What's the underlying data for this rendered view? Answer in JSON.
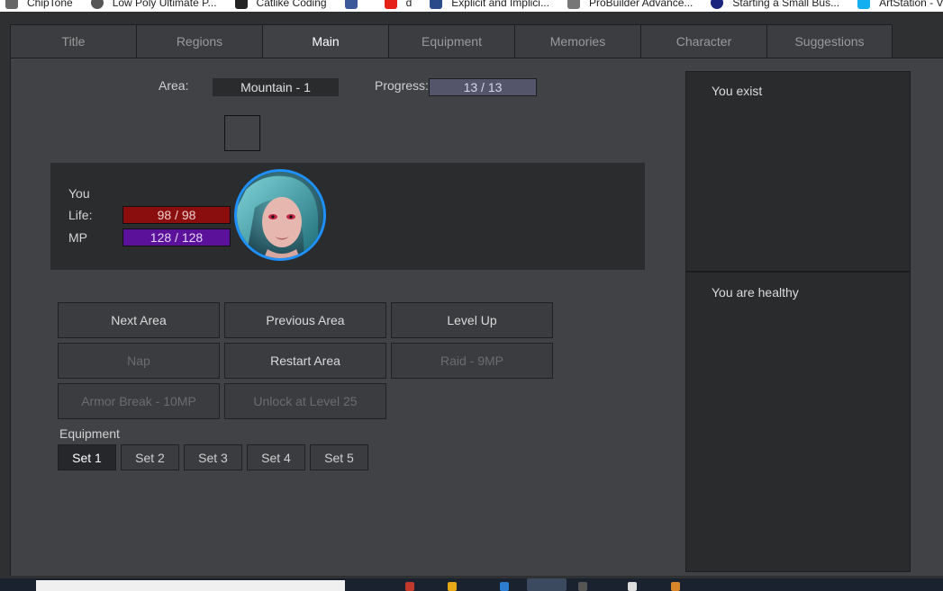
{
  "bookmarks": [
    {
      "label": "ChipTone",
      "color": "#666666"
    },
    {
      "label": "Low Poly Ultimate P...",
      "color": "#555555"
    },
    {
      "label": "Catlike Coding",
      "color": "#222222"
    },
    {
      "label": "",
      "color": "#3b5998"
    },
    {
      "label": "d",
      "color": "#e62117"
    },
    {
      "label": "Explicit and Implici...",
      "color": "#2b4a8a"
    },
    {
      "label": "ProBuilder Advance...",
      "color": "#777777"
    },
    {
      "label": "Starting a Small Bus...",
      "color": "#1a237e"
    },
    {
      "label": "ArtStation - Vitaliy...",
      "color": "#13aff0"
    }
  ],
  "tabs": [
    {
      "label": "Title"
    },
    {
      "label": "Regions"
    },
    {
      "label": "Main",
      "active": true
    },
    {
      "label": "Equipment"
    },
    {
      "label": "Memories"
    },
    {
      "label": "Character"
    },
    {
      "label": "Suggestions"
    }
  ],
  "status": {
    "area_label": "Area:",
    "area_value": "Mountain - 1",
    "progress_label": "Progress:",
    "progress_value": "13 / 13"
  },
  "character": {
    "name": "You",
    "life_label": "Life:",
    "life_value": "98 / 98",
    "mp_label": "MP",
    "mp_value": "128 / 128",
    "life_color": "#8a0e0e",
    "mp_color": "#5b1199",
    "avatar_ring_color": "#1e90ff"
  },
  "actions": {
    "next_area": "Next Area",
    "previous_area": "Previous Area",
    "level_up": "Level Up",
    "nap": "Nap",
    "restart_area": "Restart Area",
    "raid": "Raid - 9MP",
    "armor_break": "Armor Break - 10MP",
    "unlock": "Unlock at Level 25"
  },
  "equipment": {
    "label": "Equipment",
    "sets": [
      "Set 1",
      "Set 2",
      "Set 3",
      "Set 4",
      "Set 5"
    ],
    "active_set": "Set 1"
  },
  "log": {
    "top_message": "You exist",
    "bottom_message": "You are healthy"
  }
}
